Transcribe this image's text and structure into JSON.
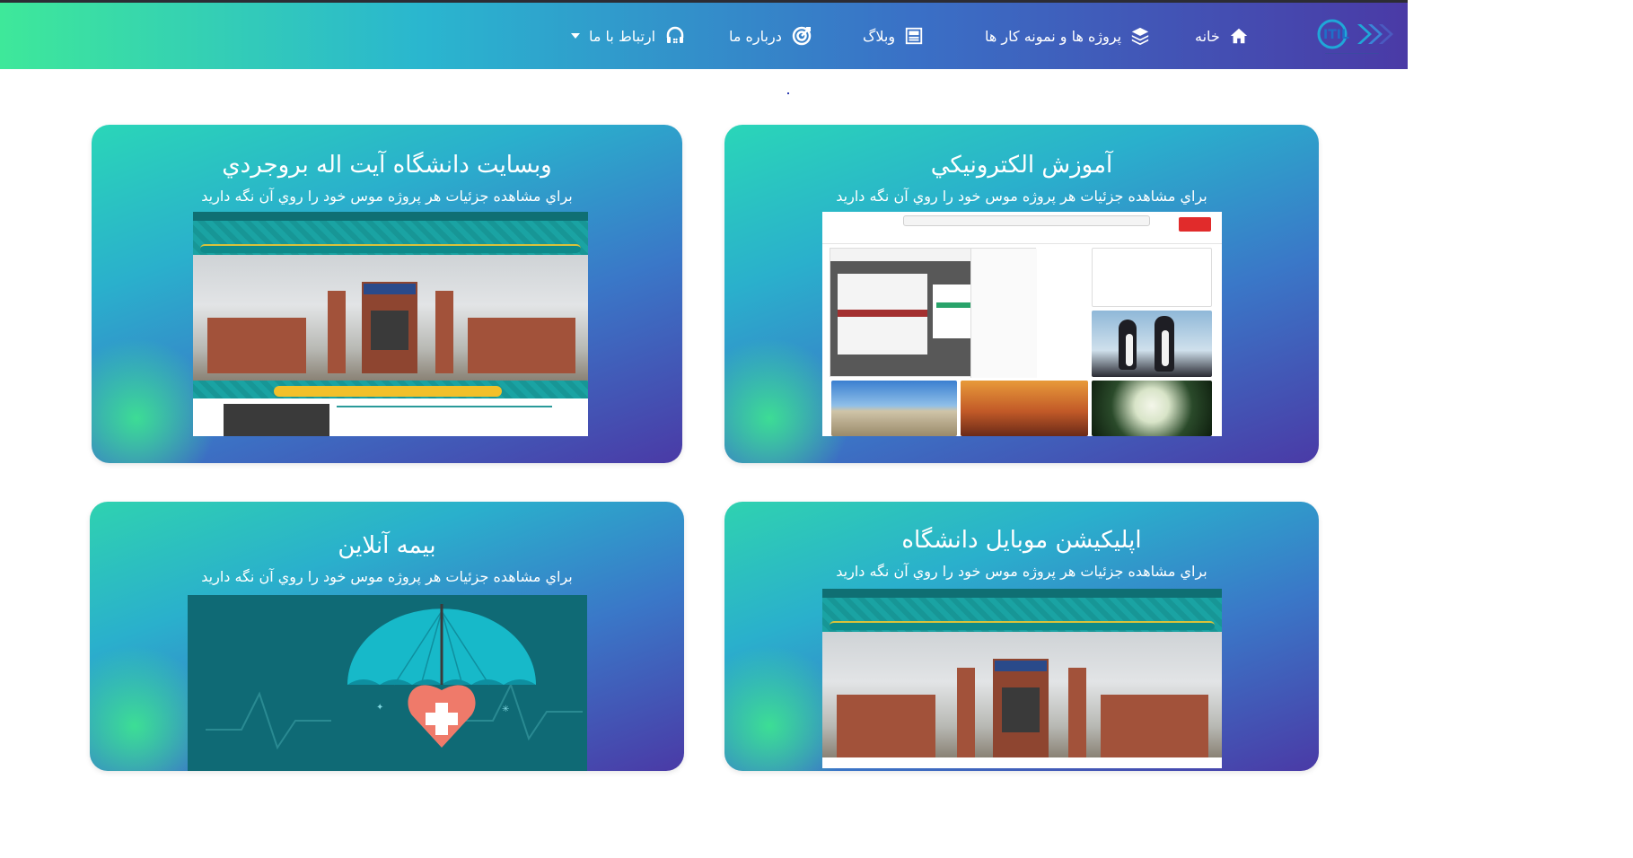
{
  "nav": {
    "logo_text": "ITIL",
    "items": [
      {
        "label": "خانه",
        "icon": "home-icon"
      },
      {
        "label": "پروژه ها و نمونه کار ها",
        "icon": "layers-icon"
      },
      {
        "label": "وبلاگ",
        "icon": "blog-icon"
      },
      {
        "label": "درباره ما",
        "icon": "target-icon"
      },
      {
        "label": "ارتباط با ما",
        "icon": "headset-icon",
        "dropdown": true
      }
    ]
  },
  "projects": [
    {
      "title": "آموزش الکترونيکي",
      "subtitle": "براي مشاهده جزئيات هر پروژه موس خود را روي آن نگه داريد",
      "preview": "elearning-screenshot"
    },
    {
      "title": "وبسايت دانشگاه آيت اله بروجردي",
      "subtitle": "براي مشاهده جزئيات هر پروژه موس خود را روي آن نگه داريد",
      "preview": "university-website-screenshot"
    },
    {
      "title": "اپليکيشن موبايل دانشگاه",
      "subtitle": "براي مشاهده جزئيات هر پروژه موس خود را روي آن نگه داريد",
      "preview": "university-app-screenshot"
    },
    {
      "title": "بيمه آنلاين",
      "subtitle": "براي مشاهده جزئيات هر پروژه موس خود را روي آن نگه داريد",
      "preview": "insurance-illustration"
    }
  ],
  "colors": {
    "nav_gradient_start": "#3ee89a",
    "nav_gradient_end": "#4a3aa6",
    "card_gradient_start": "#2ad6b8",
    "card_gradient_end": "#4a3aa6"
  }
}
